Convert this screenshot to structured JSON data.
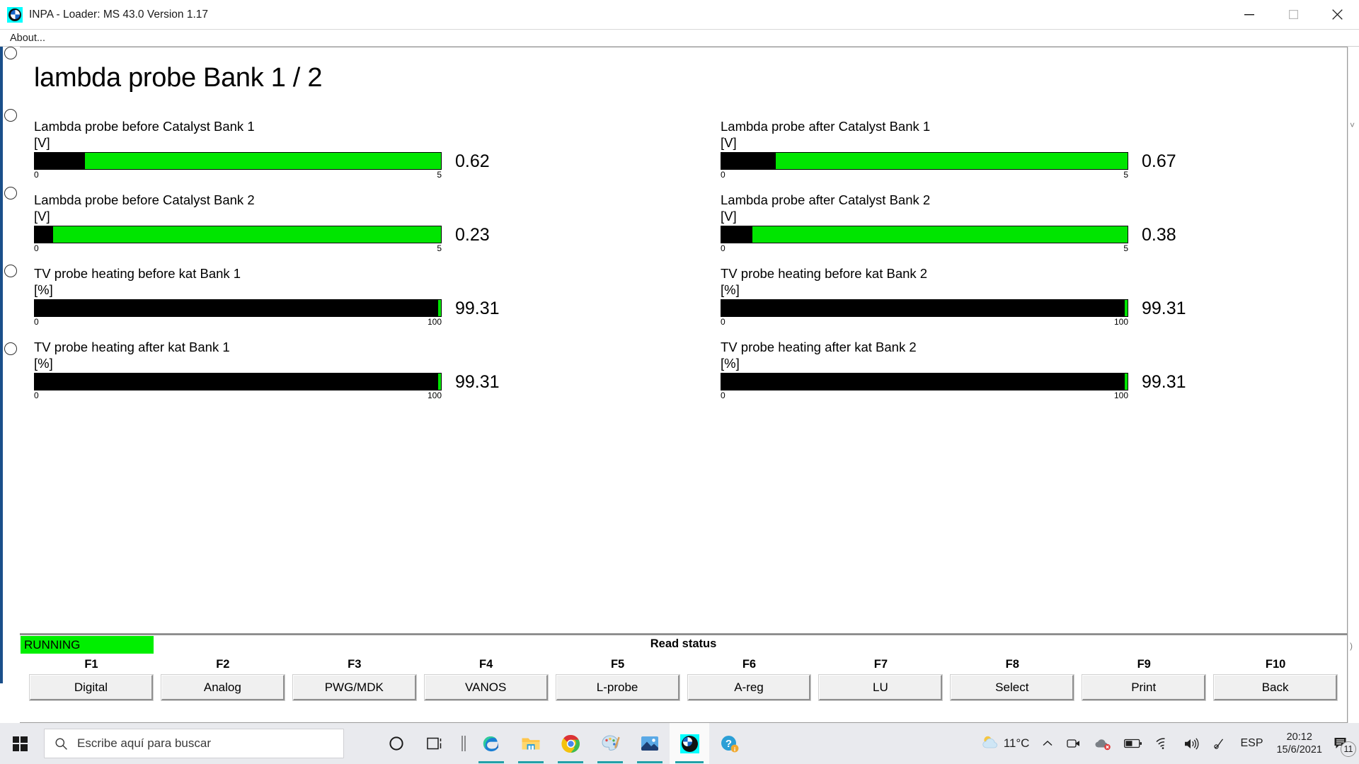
{
  "window": {
    "title": "INPA - Loader:  MS 43.0 Version 1.17",
    "app_icon": "bmw-roundel-icon",
    "minimize_label": "minimize-icon",
    "maximize_label": "maximize-icon",
    "close_label": "close-icon"
  },
  "menu": {
    "about_label": "About..."
  },
  "page": {
    "title": "lambda probe Bank 1 / 2"
  },
  "gauges": [
    {
      "label": "Lambda probe before Catalyst Bank 1",
      "unit": "[V]",
      "value": "0.62",
      "value_num": 0.62,
      "min": "0",
      "max": "5",
      "min_num": 0,
      "max_num": 5,
      "fill_percent": 12.4
    },
    {
      "label": "Lambda probe after Catalyst Bank 1",
      "unit": "[V]",
      "value": "0.67",
      "value_num": 0.67,
      "min": "0",
      "max": "5",
      "min_num": 0,
      "max_num": 5,
      "fill_percent": 13.4
    },
    {
      "label": "Lambda probe before Catalyst Bank 2",
      "unit": "[V]",
      "value": "0.23",
      "value_num": 0.23,
      "min": "0",
      "max": "5",
      "min_num": 0,
      "max_num": 5,
      "fill_percent": 4.6
    },
    {
      "label": "Lambda probe after Catalyst Bank 2",
      "unit": "[V]",
      "value": "0.38",
      "value_num": 0.38,
      "min": "0",
      "max": "5",
      "min_num": 0,
      "max_num": 5,
      "fill_percent": 7.6
    },
    {
      "label": "TV probe heating before kat Bank 1",
      "unit": "[%]",
      "value": "99.31",
      "value_num": 99.31,
      "min": "0",
      "max": "100",
      "min_num": 0,
      "max_num": 100,
      "fill_percent": 99.31
    },
    {
      "label": "TV probe heating before kat Bank 2",
      "unit": "[%]",
      "value": "99.31",
      "value_num": 99.31,
      "min": "0",
      "max": "100",
      "min_num": 0,
      "max_num": 100,
      "fill_percent": 99.31
    },
    {
      "label": "TV probe heating after kat Bank 1",
      "unit": "[%]",
      "value": "99.31",
      "value_num": 99.31,
      "min": "0",
      "max": "100",
      "min_num": 0,
      "max_num": 100,
      "fill_percent": 99.31
    },
    {
      "label": "TV probe heating after kat Bank 2",
      "unit": "[%]",
      "value": "99.31",
      "value_num": 99.31,
      "min": "0",
      "max": "100",
      "min_num": 0,
      "max_num": 100,
      "fill_percent": 99.31
    }
  ],
  "status": {
    "running_label": "RUNNING",
    "read_status_label": "Read status",
    "running_color": "#00ef00"
  },
  "function_keys": [
    {
      "key": "F1",
      "label": "Digital"
    },
    {
      "key": "F2",
      "label": "Analog"
    },
    {
      "key": "F3",
      "label": "PWG/MDK"
    },
    {
      "key": "F4",
      "label": "VANOS"
    },
    {
      "key": "F5",
      "label": "L-probe"
    },
    {
      "key": "F6",
      "label": "A-reg"
    },
    {
      "key": "F7",
      "label": "LU"
    },
    {
      "key": "F8",
      "label": "Select"
    },
    {
      "key": "F9",
      "label": "Print"
    },
    {
      "key": "F10",
      "label": "Back"
    }
  ],
  "taskbar": {
    "start_icon": "windows-logo-icon",
    "search_placeholder": "Escribe aquí para buscar",
    "search_icon": "search-icon",
    "apps": [
      {
        "icon": "cortana-icon",
        "running": false,
        "active": false
      },
      {
        "icon": "task-view-icon",
        "running": false,
        "active": false
      },
      {
        "icon": "separator-icon",
        "running": false,
        "active": false
      },
      {
        "icon": "microsoft-edge-icon",
        "running": true,
        "active": false
      },
      {
        "icon": "file-explorer-icon",
        "running": true,
        "active": false
      },
      {
        "icon": "google-chrome-icon",
        "running": true,
        "active": false
      },
      {
        "icon": "paint-icon",
        "running": true,
        "active": false
      },
      {
        "icon": "photos-icon",
        "running": true,
        "active": false
      },
      {
        "icon": "inpa-bmw-icon",
        "running": true,
        "active": true
      },
      {
        "icon": "help-icon",
        "running": false,
        "active": false
      }
    ],
    "tray": {
      "weather_icon": "partly-cloudy-icon",
      "temperature": "11°C",
      "chevron_icon": "chevron-up-icon",
      "meet_now_icon": "meet-now-icon",
      "onedrive_icon": "onedrive-error-icon",
      "battery_icon": "battery-icon",
      "wifi_icon": "wifi-icon",
      "volume_icon": "volume-icon",
      "pen_icon": "pen-icon",
      "language": "ESP",
      "time": "20:12",
      "date": "15/6/2021",
      "notifications_icon": "notifications-icon",
      "notifications_count": "11"
    }
  }
}
